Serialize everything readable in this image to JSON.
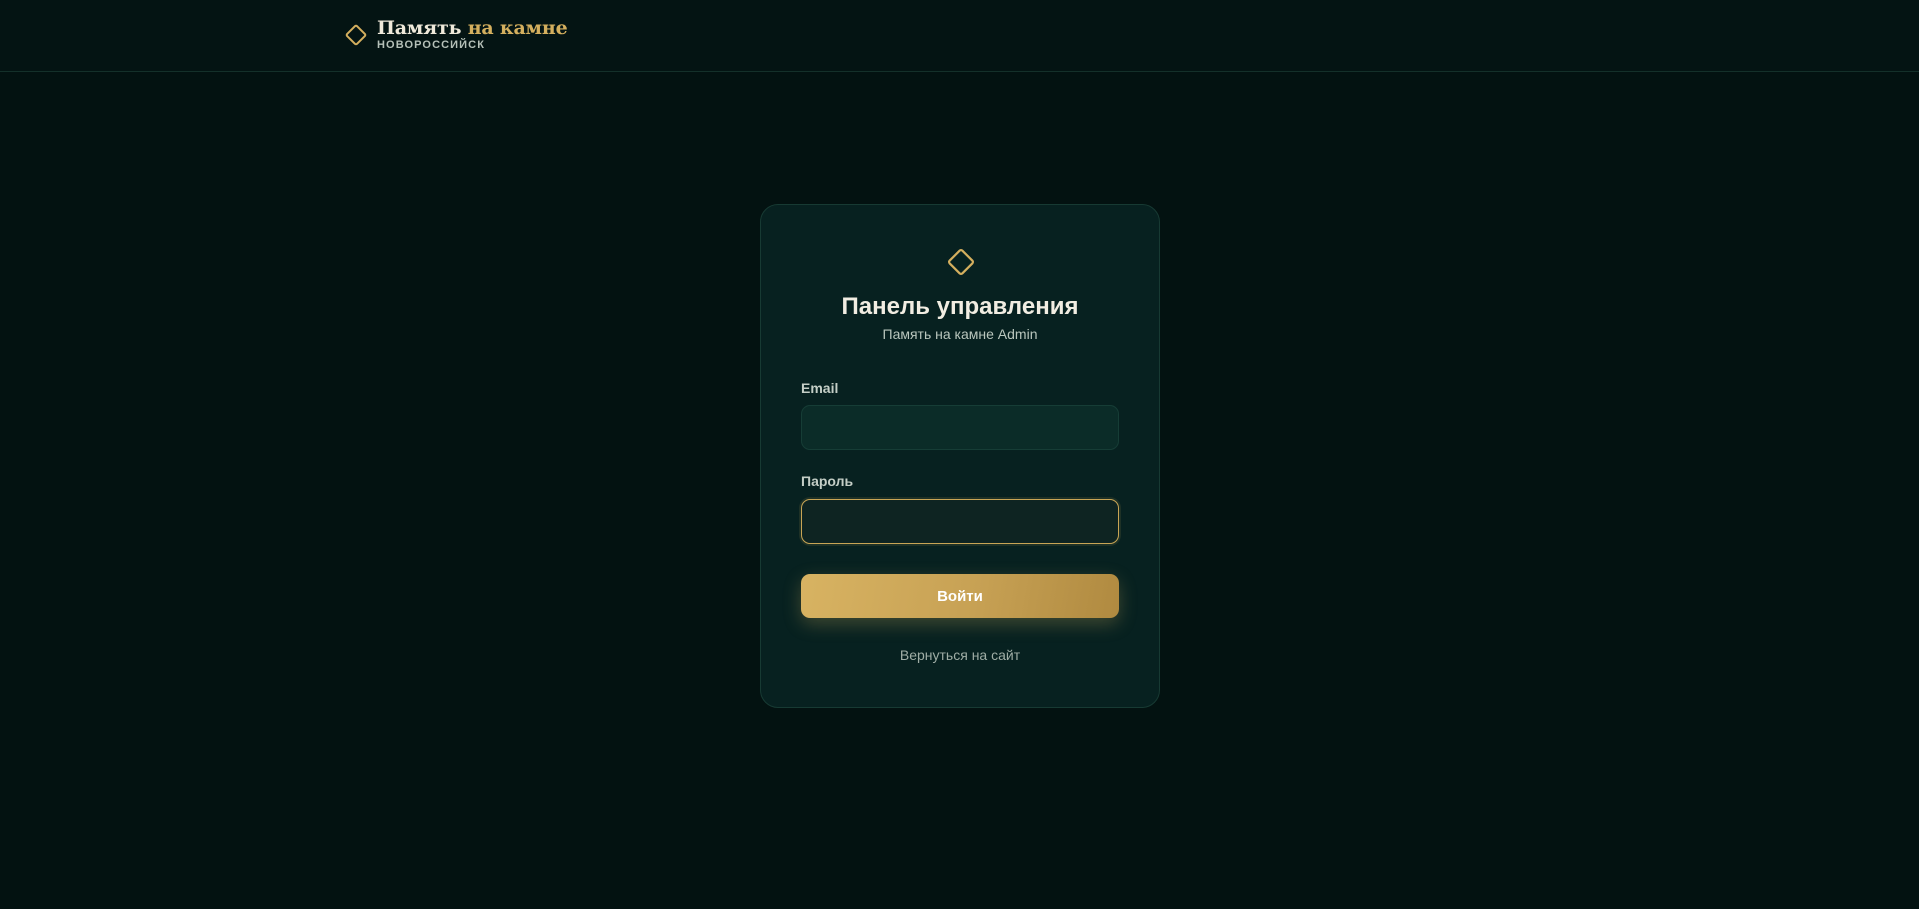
{
  "header": {
    "brand_title_main": "Память",
    "brand_title_accent": "на камне",
    "brand_subtitle": "НОВОРОССИЙСК",
    "logo_icon": "diamond-outline-icon"
  },
  "login_card": {
    "icon": "diamond-outline-icon",
    "title": "Панель управления",
    "subtitle": "Память на камне Admin",
    "email_label": "Email",
    "email_value": "",
    "password_label": "Пароль",
    "password_value": "",
    "submit_label": "Войти",
    "back_link": "Вернуться на сайт"
  },
  "colors": {
    "background": "#031211",
    "card": "#072120",
    "accent_gold": "#d4af5e",
    "text_light": "#f1ede2"
  }
}
